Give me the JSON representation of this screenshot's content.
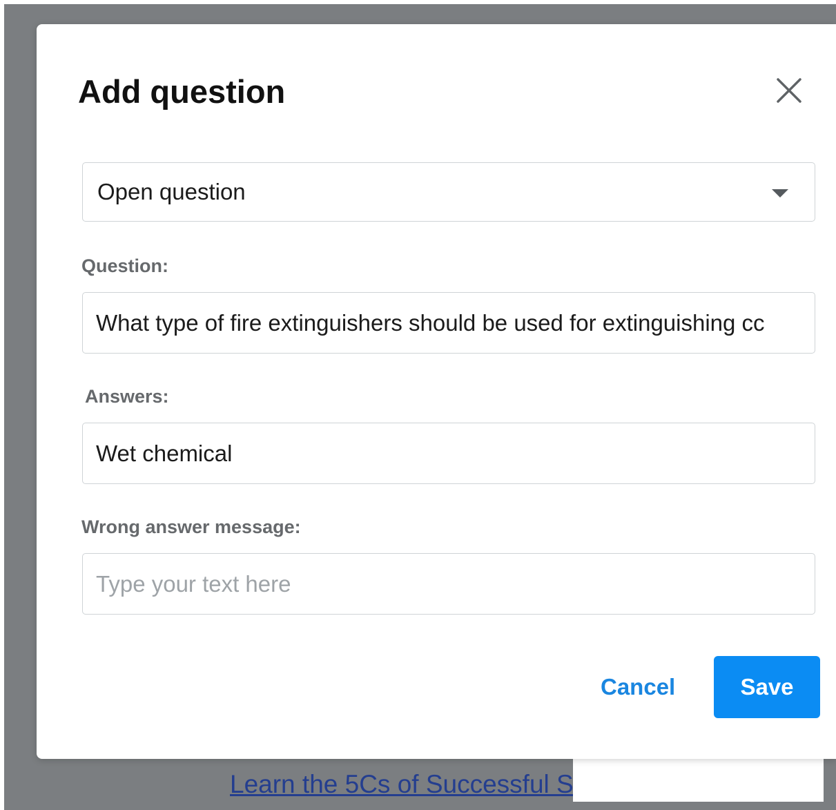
{
  "background": {
    "link_text": "Learn the 5Cs of Successful S"
  },
  "dialog": {
    "title": "Add question",
    "close_icon": "close-icon",
    "question_type": {
      "selected": "Open question",
      "icon": "chevron-down-icon"
    },
    "question": {
      "label": "Question:",
      "value": "What type of fire extinguishers should be used for extinguishing cc"
    },
    "answers": {
      "label": "Answers:",
      "value": "Wet chemical"
    },
    "wrong_answer": {
      "label": "Wrong answer message:",
      "placeholder": "Type your text here"
    },
    "cancel_label": "Cancel",
    "save_label": "Save"
  },
  "colors": {
    "backdrop": "#7b7e81",
    "primary": "#0b8cf3",
    "link_blue": "#1a86e0",
    "label_gray": "#66696c",
    "border": "#cfd3d6"
  }
}
